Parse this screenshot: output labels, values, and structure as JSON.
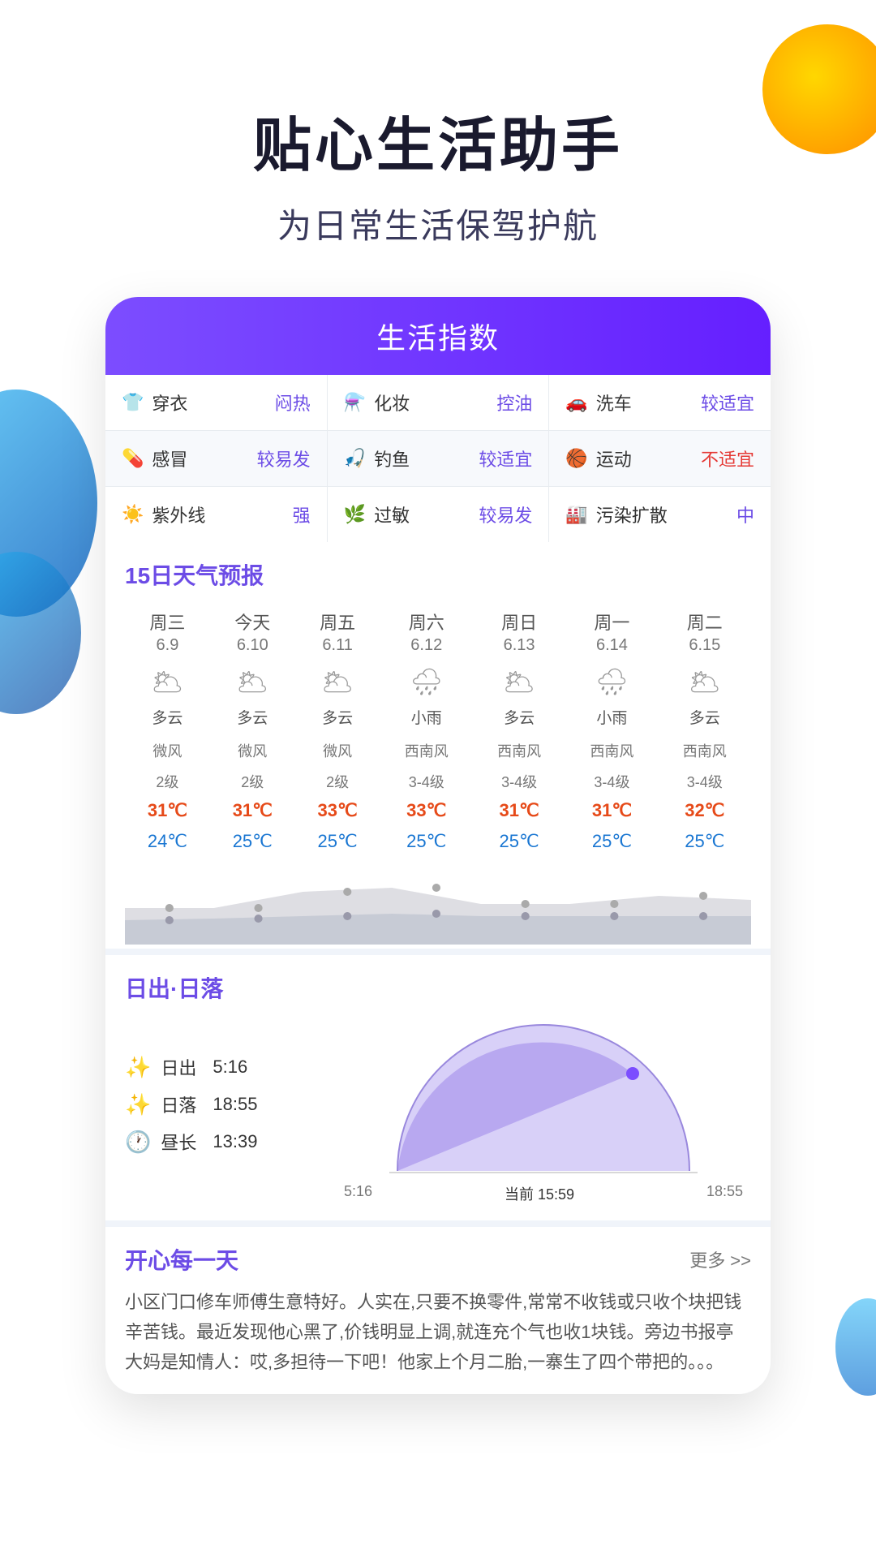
{
  "header": {
    "main_title": "贴心生活助手",
    "sub_title": "为日常生活保驾护航"
  },
  "life_index": {
    "title": "生活指数",
    "rows": [
      [
        {
          "icon": "👕",
          "label": "穿衣",
          "value": "闷热",
          "shaded": false
        },
        {
          "icon": "💄",
          "label": "化妆",
          "value": "控油",
          "shaded": false
        },
        {
          "icon": "🚗",
          "label": "洗车",
          "value": "较适宜",
          "shaded": false
        }
      ],
      [
        {
          "icon": "💊",
          "label": "感冒",
          "value": "较易发",
          "shaded": true
        },
        {
          "icon": "🎣",
          "label": "钓鱼",
          "value": "较适宜",
          "shaded": true
        },
        {
          "icon": "🏀",
          "label": "运动",
          "value": "不适宜",
          "shaded": true,
          "red": true
        }
      ],
      [
        {
          "icon": "☀️",
          "label": "紫外线",
          "value": "强",
          "shaded": false
        },
        {
          "icon": "🌿",
          "label": "过敏",
          "value": "较易发",
          "shaded": false
        },
        {
          "icon": "🏭",
          "label": "污染扩散",
          "value": "中",
          "shaded": false
        }
      ]
    ]
  },
  "forecast": {
    "section_title": "15日天气预报",
    "days": [
      {
        "day": "周三",
        "date": "6.9",
        "icon": "🌥",
        "weather": "多云",
        "wind": "微风",
        "wind_level": "2级",
        "high": "31℃",
        "low": "24℃"
      },
      {
        "day": "今天",
        "date": "6.10",
        "icon": "🌥",
        "weather": "多云",
        "wind": "微风",
        "wind_level": "2级",
        "high": "31℃",
        "low": "25℃"
      },
      {
        "day": "周五",
        "date": "6.11",
        "icon": "🌥",
        "weather": "多云",
        "wind": "微风",
        "wind_level": "2级",
        "high": "33℃",
        "low": "25℃"
      },
      {
        "day": "周六",
        "date": "6.12",
        "icon": "🌧",
        "weather": "小雨",
        "wind": "西南风",
        "wind_level": "3-4级",
        "high": "33℃",
        "low": "25℃"
      },
      {
        "day": "周日",
        "date": "6.13",
        "icon": "🌥",
        "weather": "多云",
        "wind": "西南风",
        "wind_level": "3-4级",
        "high": "31℃",
        "low": "25℃"
      },
      {
        "day": "周一",
        "date": "6.14",
        "icon": "🌧",
        "weather": "小雨",
        "wind": "西南风",
        "wind_level": "3-4级",
        "high": "31℃",
        "low": "25℃"
      },
      {
        "day": "周二",
        "date": "6.15",
        "icon": "🌥",
        "weather": "多云",
        "wind": "西南风",
        "wind_level": "3-4级",
        "high": "32℃",
        "low": "25℃"
      }
    ]
  },
  "sunrise": {
    "section_title": "日出·日落",
    "sunrise_label": "日出",
    "sunrise_time": "5:16",
    "sunset_label": "日落",
    "sunset_time": "18:55",
    "duration_label": "昼长",
    "duration_time": "13:39",
    "arc_labels": {
      "start": "5:16",
      "current": "当前 15:59",
      "end": "18:55"
    }
  },
  "joy": {
    "section_title": "开心每一天",
    "more_label": "更多 >>",
    "content": "小区门口修车师傅生意特好。人实在,只要不换零件,常常不收钱或只收个块把钱辛苦钱。最近发现他心黑了,价钱明显上调,就连充个气也收1块钱。旁边书报亭大妈是知情人：哎,多担待一下吧！他家上个月二胎,一寨生了四个带把的。。。"
  }
}
